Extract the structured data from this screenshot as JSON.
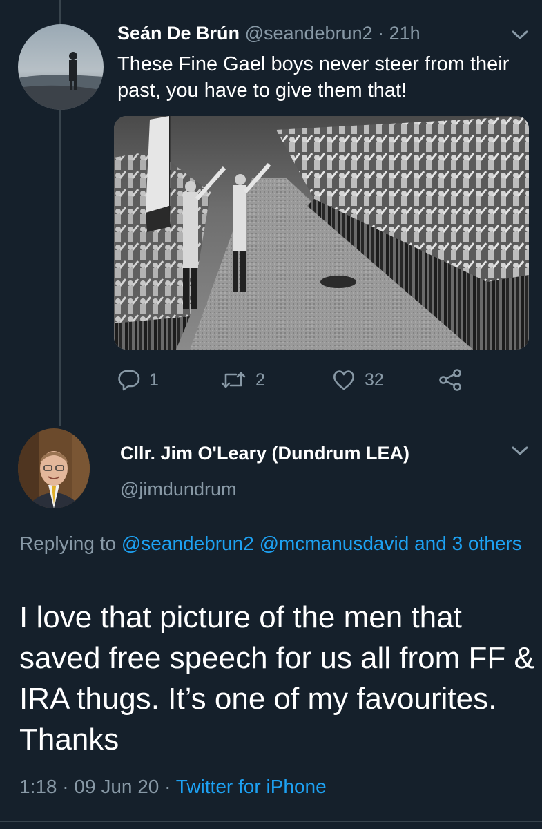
{
  "tweet1": {
    "author_name": "Seán De Brún",
    "author_handle": "@seandebrun2",
    "separator": "·",
    "time": "21h",
    "text": "These Fine Gael boys never steer from their past, you have to give them that!",
    "counts": {
      "replies": "1",
      "retweets": "2",
      "likes": "32"
    }
  },
  "tweet2": {
    "author_name": "Cllr. Jim O'Leary (Dundrum LEA)",
    "author_handle": "@jimdundrum",
    "replying_prefix": "Replying to",
    "replying_to_1": "@seandebrun2",
    "replying_to_2": "@mcmanusdavid",
    "replying_and": "and",
    "replying_others": "3 others",
    "text": "I love that picture of the men that saved free speech for us all from FF & IRA thugs. It’s one of my favourites. Thanks",
    "time": "1:18",
    "date": "09 Jun 20",
    "separator": "·",
    "source": "Twitter for iPhone"
  },
  "icons": {
    "reply": "reply-icon",
    "retweet": "retweet-icon",
    "like": "heart-icon",
    "share": "share-icon",
    "menu": "chevron-down-icon"
  },
  "colors": {
    "background": "#15202b",
    "muted": "#8899a6",
    "link": "#1da1f2",
    "divider": "#38444d"
  }
}
